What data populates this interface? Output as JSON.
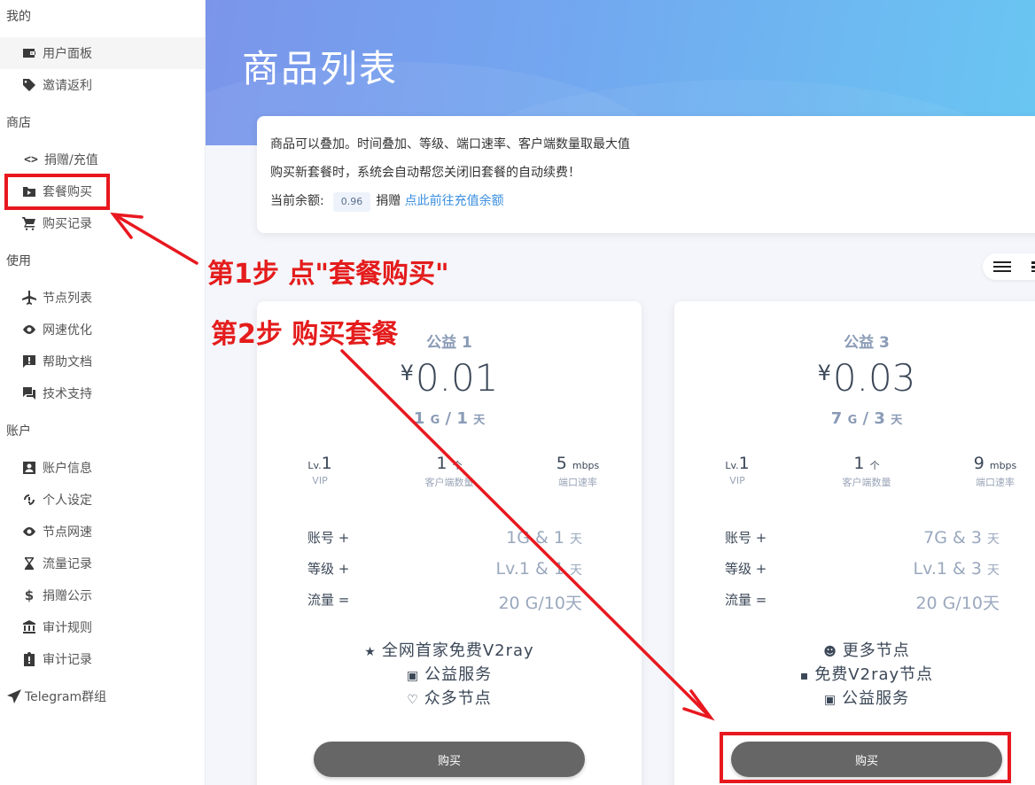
{
  "sidebar": {
    "sections": [
      "我的",
      "商店",
      "使用",
      "账户"
    ],
    "items": [
      {
        "label": "用户面板"
      },
      {
        "label": "邀请返利"
      },
      {
        "label": "捐赠/充值"
      },
      {
        "label": "套餐购买"
      },
      {
        "label": "购买记录"
      },
      {
        "label": "节点列表"
      },
      {
        "label": "网速优化"
      },
      {
        "label": "帮助文档"
      },
      {
        "label": "技术支持"
      },
      {
        "label": "账户信息"
      },
      {
        "label": "个人设定"
      },
      {
        "label": "节点网速"
      },
      {
        "label": "流量记录"
      },
      {
        "label": "捐赠公示"
      },
      {
        "label": "审计规则"
      },
      {
        "label": "审计记录"
      }
    ],
    "telegram": "Telegram群组"
  },
  "header": {
    "title": "商品列表"
  },
  "notice": {
    "line1": "商品可以叠加。时间叠加、等级、端口速率、客户端数量取最大值",
    "line2": "购买新套餐时，系统会自动帮您关闭旧套餐的自动续费！",
    "balance_label": "当前余额:",
    "balance_value": "0.96",
    "donate_label": "捐赠",
    "recharge_link": "点此前往充值余额"
  },
  "plans": [
    {
      "name": "公益 1",
      "currency": "¥",
      "price": "0.01",
      "traffic": "1",
      "traffic_unit": "G",
      "days": "1",
      "days_unit": "天",
      "sep": "/",
      "level_prefix": "Lv.",
      "level": "1",
      "level_label": "VIP",
      "clients": "1",
      "clients_unit": "个",
      "clients_label": "客户端数量",
      "speed": "5",
      "speed_unit": "mbps",
      "speed_label": "端口速率",
      "account_label": "账号 +",
      "account_value": "1G & 1",
      "account_unit": "天",
      "level_row_label": "等级 +",
      "level_row_value": "Lv.1 & 1",
      "level_row_unit": "天",
      "traffic_row_label": "流量 =",
      "traffic_row_value": "20 G/10天",
      "features": [
        {
          "icon": "★",
          "text": "全网首家免费V2ray"
        },
        {
          "icon": "▣",
          "text": "公益服务"
        },
        {
          "icon": "♡",
          "text": "众多节点"
        }
      ],
      "buy_label": "购买"
    },
    {
      "name": "公益 3",
      "currency": "¥",
      "price": "0.03",
      "traffic": "7",
      "traffic_unit": "G",
      "days": "3",
      "days_unit": "天",
      "sep": "/",
      "level_prefix": "Lv.",
      "level": "1",
      "level_label": "VIP",
      "clients": "1",
      "clients_unit": "个",
      "clients_label": "客户端数量",
      "speed": "9",
      "speed_unit": "mbps",
      "speed_label": "端口速率",
      "account_label": "账号 +",
      "account_value": "7G & 3",
      "account_unit": "天",
      "level_row_label": "等级 +",
      "level_row_value": "Lv.1 & 3",
      "level_row_unit": "天",
      "traffic_row_label": "流量 =",
      "traffic_row_value": "20 G/10天",
      "features": [
        {
          "icon": "☻",
          "text": "更多节点"
        },
        {
          "icon": "▪",
          "text": "免费V2ray节点"
        },
        {
          "icon": "▣",
          "text": "公益服务"
        }
      ],
      "buy_label": "购买"
    }
  ],
  "annotations": {
    "step1": "第1步 点\"套餐购买\"",
    "step2": "第2步 购买套餐",
    "color": "#e41c1c"
  }
}
